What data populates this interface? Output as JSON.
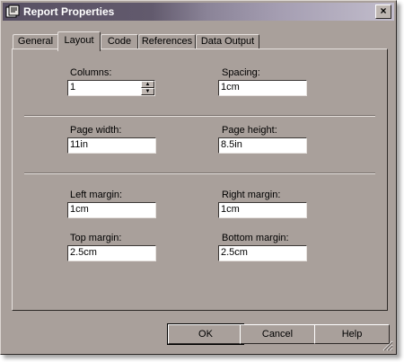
{
  "window": {
    "title": "Report Properties",
    "close_label": "×"
  },
  "tabs": [
    {
      "label": "General"
    },
    {
      "label": "Layout"
    },
    {
      "label": "Code"
    },
    {
      "label": "References"
    },
    {
      "label": "Data Output"
    }
  ],
  "layout": {
    "columns": {
      "label": "Columns:",
      "value": "1"
    },
    "spacing": {
      "label": "Spacing:",
      "value": "1cm"
    },
    "page_width": {
      "label": "Page width:",
      "value": "11in"
    },
    "page_height": {
      "label": "Page height:",
      "value": "8.5in"
    },
    "left_margin": {
      "label": "Left margin:",
      "value": "1cm"
    },
    "right_margin": {
      "label": "Right margin:",
      "value": "1cm"
    },
    "top_margin": {
      "label": "Top margin:",
      "value": "2.5cm"
    },
    "bottom_margin": {
      "label": "Bottom margin:",
      "value": "2.5cm"
    }
  },
  "buttons": {
    "ok": "OK",
    "cancel": "Cancel",
    "help": "Help"
  },
  "icons": {
    "title": "report-properties-icon",
    "close": "close-icon",
    "spin_up": "arrow-up-icon",
    "spin_down": "arrow-down-icon",
    "grip": "resize-grip-icon"
  },
  "colors": {
    "dialog_bg": "#a9a09b",
    "title_start": "#585063",
    "title_end": "#c2bdcc"
  }
}
